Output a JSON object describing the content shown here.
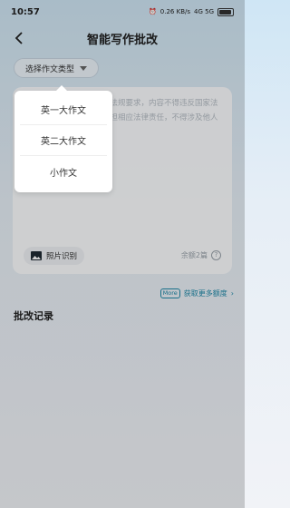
{
  "status_bar": {
    "time": "10:57",
    "net_speed": "0.26 KB/s",
    "network": "4G 5G",
    "battery": "80"
  },
  "header": {
    "title": "智能写作批改"
  },
  "type_selector": {
    "label": "选择作文类型"
  },
  "essay_input": {
    "placeholder": "请输入作文内容，应法律法规要求，内容不得违反国家法律法规，一被封号以及承担相应法律责任，不得涉及他人个人隐私及违法违规内容"
  },
  "photo_button": {
    "label": "照片识别"
  },
  "remaining": {
    "text": "余额2篇"
  },
  "more_quota": {
    "badge": "More",
    "label": "获取更多额度"
  },
  "history": {
    "title": "批改记录"
  },
  "dropdown": {
    "options": [
      "英一大作文",
      "英二大作文",
      "小作文"
    ]
  },
  "colors": {
    "accent": "#1e88a8",
    "background_top": "#cfe6f5"
  }
}
